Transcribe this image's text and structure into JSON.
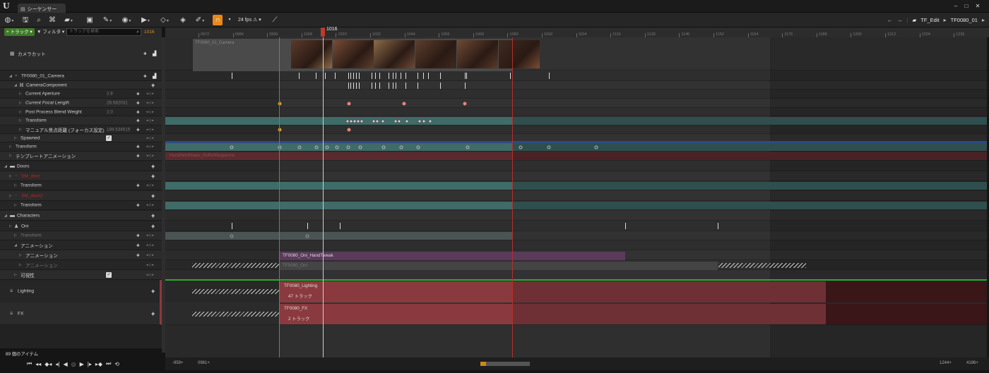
{
  "window": {
    "tab_title": "シーケンサー",
    "logo": "U",
    "minimize": "‒",
    "maximize": "□",
    "close": "✕"
  },
  "toolbar": {
    "fps_label": "24 fps",
    "breadcrumb_parent": "TF_Edit",
    "breadcrumb_current": "TF0080_01",
    "icons": [
      "save-icon",
      "search-icon",
      "camera-icon",
      "clapper-icon",
      "render-icon",
      "tools-icon",
      "eye-icon",
      "play-icon",
      "key-icon",
      "curve-icon",
      "pen-icon",
      "magnet-icon",
      "fps-icon",
      "graph-icon"
    ]
  },
  "left_panel": {
    "track_button": "+ トラック ▾",
    "filter_button": "▼ フィルタ ▾",
    "search_placeholder": "トラックを検索",
    "current_frame": "1016",
    "items_count": "89 個のアイテム"
  },
  "tree": [
    {
      "label": "カメラカット",
      "indent": 0,
      "type": "header"
    },
    {
      "label": "TF0080_01_Camera",
      "indent": 1,
      "type": "actor"
    },
    {
      "label": "CameraComponent",
      "indent": 2,
      "type": "component"
    },
    {
      "label": "Current Aperture",
      "value": "2.8",
      "indent": 3
    },
    {
      "label": "Current Focal Length",
      "value": "26.582031",
      "indent": 3
    },
    {
      "label": "Post Process Blend Weight",
      "value": "2.0",
      "indent": 3
    },
    {
      "label": "Transform",
      "indent": 3
    },
    {
      "label": "マニュアル焦点距離 (フォーカス設定)",
      "value": "189.534515",
      "indent": 3
    },
    {
      "label": "Spawned",
      "indent": 2,
      "checkbox": true
    },
    {
      "label": "Transform",
      "indent": 1
    },
    {
      "label": "テンプレートアニメーション",
      "indent": 1
    },
    {
      "label": "Doors",
      "indent": 0,
      "type": "folder"
    },
    {
      "label": "SM_door",
      "indent": 1,
      "red": true
    },
    {
      "label": "Transform",
      "indent": 2
    },
    {
      "label": "SM_door2",
      "indent": 1,
      "red": true
    },
    {
      "label": "Transform",
      "indent": 2
    },
    {
      "label": "Characters",
      "indent": 0,
      "type": "folder"
    },
    {
      "label": "Oni",
      "indent": 1
    },
    {
      "label": "Transform",
      "indent": 2,
      "dim": true
    },
    {
      "label": "アニメーション",
      "indent": 2
    },
    {
      "label": "アニメーション",
      "indent": 3
    },
    {
      "label": "アニメーション",
      "indent": 3,
      "dim": true
    },
    {
      "label": "可視性",
      "indent": 2,
      "checkbox": true
    },
    {
      "label": "Lighting",
      "indent": 0,
      "type": "sub"
    },
    {
      "label": "FX",
      "indent": 0,
      "type": "sub"
    }
  ],
  "ruler": {
    "current": "1016",
    "ticks": [
      "0972",
      "0984",
      "0996",
      "1008",
      "1020",
      "1032",
      "1044",
      "1056",
      "1068",
      "1080",
      "1092",
      "1104",
      "1116",
      "1128",
      "1140",
      "1152",
      "1164",
      "1176",
      "1188",
      "1200",
      "1212",
      "1224",
      "1236"
    ]
  },
  "sections": {
    "camera_cut": "TF0080_01_Camera",
    "camera_shake": "HandHeldShake_NoRollSequence",
    "oni_anim_1": "TF0080_Oni_HandTweak",
    "oni_anim_2": "TF0080_Oni",
    "lighting_name": "TF0080_Lighting",
    "lighting_tracks": "47 トラック",
    "fx_name": "TF0080_FX",
    "fx_tracks": "2 トラック"
  },
  "bottom": {
    "view_start": "-959+",
    "play_start": "0961+",
    "play_end": "1244+",
    "view_end": "4196+"
  },
  "colors": {
    "accent": "#e8891a",
    "teal_track": "#3f6b68",
    "red_track": "#8a3a3e",
    "purple_section": "#5a3b5a",
    "keyframe": "#e9847a",
    "green_marker": "#2fa82f",
    "red_marker": "#b0302c"
  }
}
